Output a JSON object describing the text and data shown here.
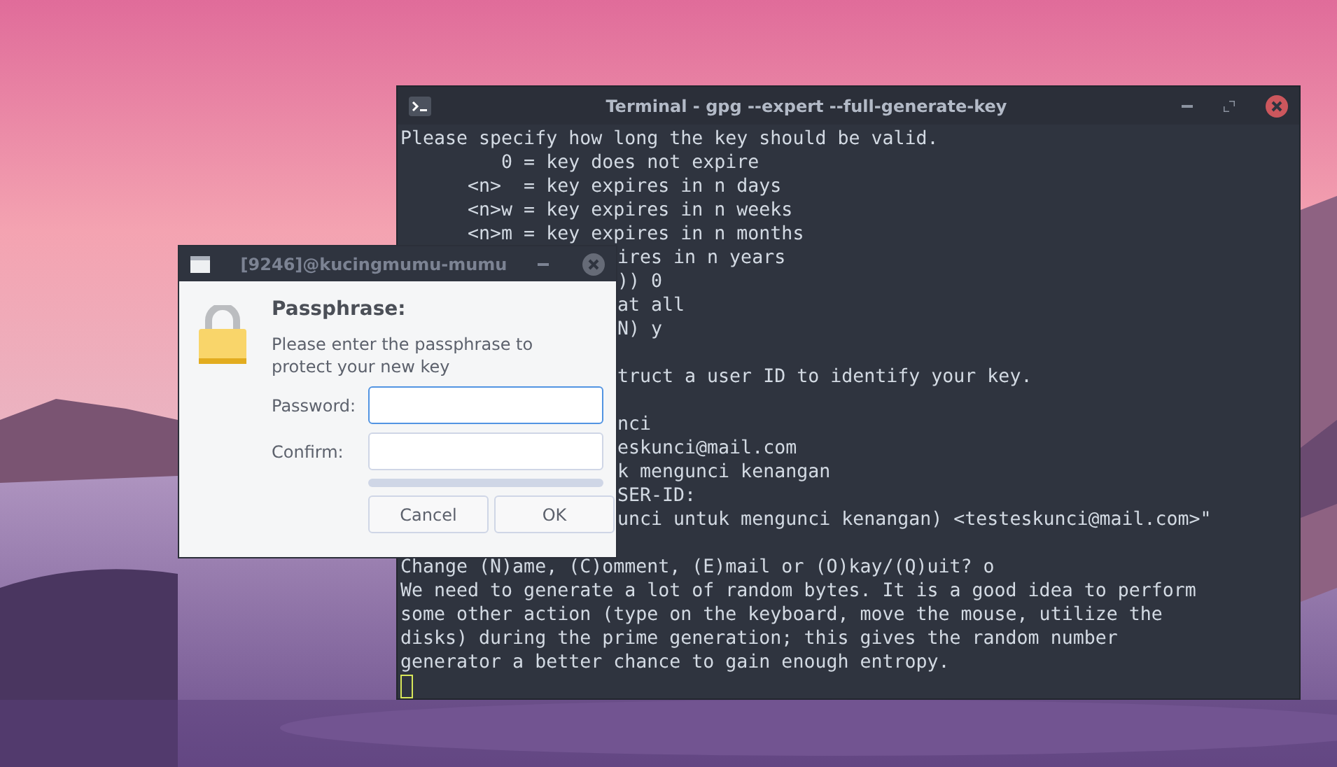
{
  "terminal": {
    "title": "Terminal - gpg --expert --full-generate-key",
    "lines": [
      {
        "kind": "full",
        "text": "Please specify how long the key should be valid."
      },
      {
        "kind": "full",
        "text": "         0 = key does not expire"
      },
      {
        "kind": "full",
        "text": "      <n>  = key expires in n days"
      },
      {
        "kind": "full",
        "text": "      <n>w = key expires in n weeks"
      },
      {
        "kind": "full",
        "text": "      <n>m = key expires in n months"
      },
      {
        "kind": "covered",
        "text": "ires in n years"
      },
      {
        "kind": "covered",
        "text": ")) 0"
      },
      {
        "kind": "covered",
        "text": "at all"
      },
      {
        "kind": "covered",
        "text": "N) y"
      },
      {
        "kind": "blank"
      },
      {
        "kind": "covered",
        "text": "truct a user ID to identify your key."
      },
      {
        "kind": "blank"
      },
      {
        "kind": "covered",
        "text": "nci"
      },
      {
        "kind": "covered",
        "text": "eskunci@mail.com"
      },
      {
        "kind": "covered",
        "text": "k mengunci kenangan"
      },
      {
        "kind": "covered",
        "text": "SER-ID:"
      },
      {
        "kind": "covered",
        "text": "unci untuk mengunci kenangan) <testeskunci@mail.com>\""
      },
      {
        "kind": "blank"
      },
      {
        "kind": "full",
        "text": "Change (N)ame, (C)omment, (E)mail or (O)kay/(Q)uit? o"
      },
      {
        "kind": "full",
        "text": "We need to generate a lot of random bytes. It is a good idea to perform"
      },
      {
        "kind": "full",
        "text": "some other action (type on the keyboard, move the mouse, utilize the"
      },
      {
        "kind": "full",
        "text": "disks) during the prime generation; this gives the random number"
      },
      {
        "kind": "full",
        "text": "generator a better chance to gain enough entropy."
      }
    ]
  },
  "dialog": {
    "title": "[9246]@kucingmumu-mumu",
    "heading": "Passphrase:",
    "message": "Please enter the passphrase to protect your new key",
    "fields": [
      {
        "label": "Password:",
        "focused": true
      },
      {
        "label": "Confirm:",
        "focused": false
      }
    ],
    "quality": {
      "level": 0
    },
    "buttons": [
      "Cancel",
      "OK"
    ]
  }
}
